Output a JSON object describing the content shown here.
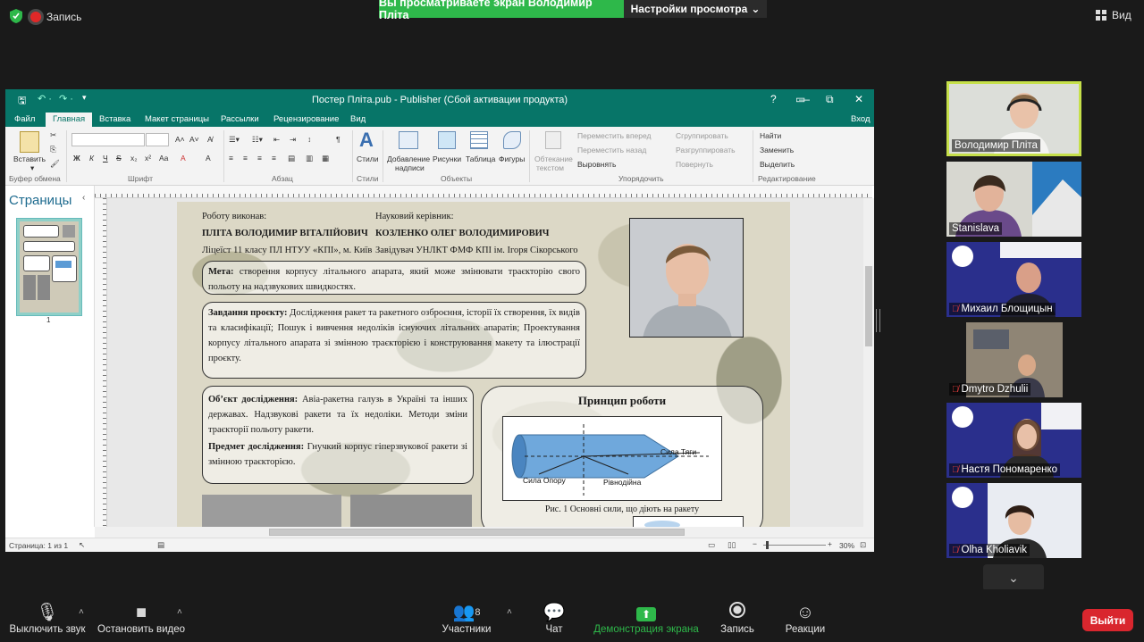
{
  "topbar": {
    "record_label": "Запись",
    "share_banner": "Вы просматриваете экран Володимир Пліта",
    "view_settings": "Настройки просмотра",
    "view_label": "Вид"
  },
  "publisher": {
    "title": "Постер Пліта.pub - Publisher (Сбой активации продукта)",
    "help": "?",
    "sign_in": "Вход",
    "tabs": [
      "Файл",
      "Главная",
      "Вставка",
      "Макет страницы",
      "Рассылки",
      "Рецензирование",
      "Вид"
    ],
    "ribbon": {
      "paste": "Вставить",
      "groups": [
        "Буфер обмена",
        "Шрифт",
        "Абзац",
        "Стили",
        "Объекты",
        "Упорядочить",
        "Редактирование"
      ],
      "styles": "Стили",
      "add_caption_1": "Добавление",
      "add_caption_2": "надписи",
      "pictures": "Рисунки",
      "table": "Таблица",
      "shapes": "Фигуры",
      "wrap_1": "Обтекание",
      "wrap_2": "текстом",
      "bring_forward": "Переместить вперед",
      "send_backward": "Переместить назад",
      "align": "Выровнять",
      "group": "Сгруппировать",
      "ungroup": "Разгруппировать",
      "rotate": "Повернуть",
      "find": "Найти",
      "replace": "Заменить",
      "select": "Выделить"
    },
    "pages_title": "Страницы",
    "thumb_number": "1",
    "status_page": "Страница: 1 из 1",
    "zoom": "30%"
  },
  "poster": {
    "author_label": "Роботу виконав:",
    "author_name": "ПЛІТА ВОЛОДИМИР ВІТАЛІЙОВИЧ",
    "author_school": "Ліцеїст 11 класу ПЛ НТУУ «КПІ», м. Київ",
    "supervisor_label": "Науковий керівник:",
    "supervisor_name": "КОЗЛЕНКО ОЛЕГ ВОЛОДИМИРОВИЧ",
    "supervisor_role": "Завідувач УНЛКТ ФМФ КПІ ім. Ігоря Сікорського",
    "goal_label": "Мета:",
    "goal_text": "створення корпусу літального апарата, який може змінювати траєкторію свого польоту на надзвукових швидкостях.",
    "tasks_label": "Завдання проєкту:",
    "tasks_text": "Дослідження ракет та ракетного озброєння, історії їх створення, їх видів та класифікації; Пошук і вивчення недоліків існуючих літальних апаратів; Проектування корпусу літального апарата зі змінною траєкторією і конструювання макету та ілюстрації проєкту.",
    "object_label": "Об’єкт дослідження:",
    "object_text": "Авіа-ракетна галузь в Україні та інших державах. Надзвукові ракети та їх недоліки. Методи зміни траєкторії польоту ракети.",
    "subject_label": "Предмет дослідження:",
    "subject_text": "Гнучкий корпус гіперзвукової ракети зі змінною траєкторією.",
    "principle_title": "Принцип роботи",
    "diagram_labels": [
      "Сила Тяги",
      "Сила Опору",
      "Рівнодійна"
    ],
    "figure_caption": "Рис. 1 Основні сили, що діють на ракету"
  },
  "participants": [
    {
      "name": "Володимир Пліта",
      "muted": false
    },
    {
      "name": "Stanislava",
      "muted": false
    },
    {
      "name": "Михаил Блощицын",
      "muted": true
    },
    {
      "name": "Dmytro Dzhulii",
      "muted": true
    },
    {
      "name": "Настя Пономаренко",
      "muted": true
    },
    {
      "name": "Olha Kholiavik",
      "muted": true
    }
  ],
  "toolbar": {
    "mute": "Выключить звук",
    "video": "Остановить видео",
    "participants": "Участники",
    "participants_count": "8",
    "chat": "Чат",
    "share": "Демонстрация экрана",
    "record": "Запись",
    "reactions": "Реакции",
    "leave": "Выйти"
  },
  "colors": {
    "share_green": "#2eb84a",
    "publisher_teal": "#077568",
    "leave_red": "#d9262e",
    "active_speaker": "#c6e04a"
  }
}
